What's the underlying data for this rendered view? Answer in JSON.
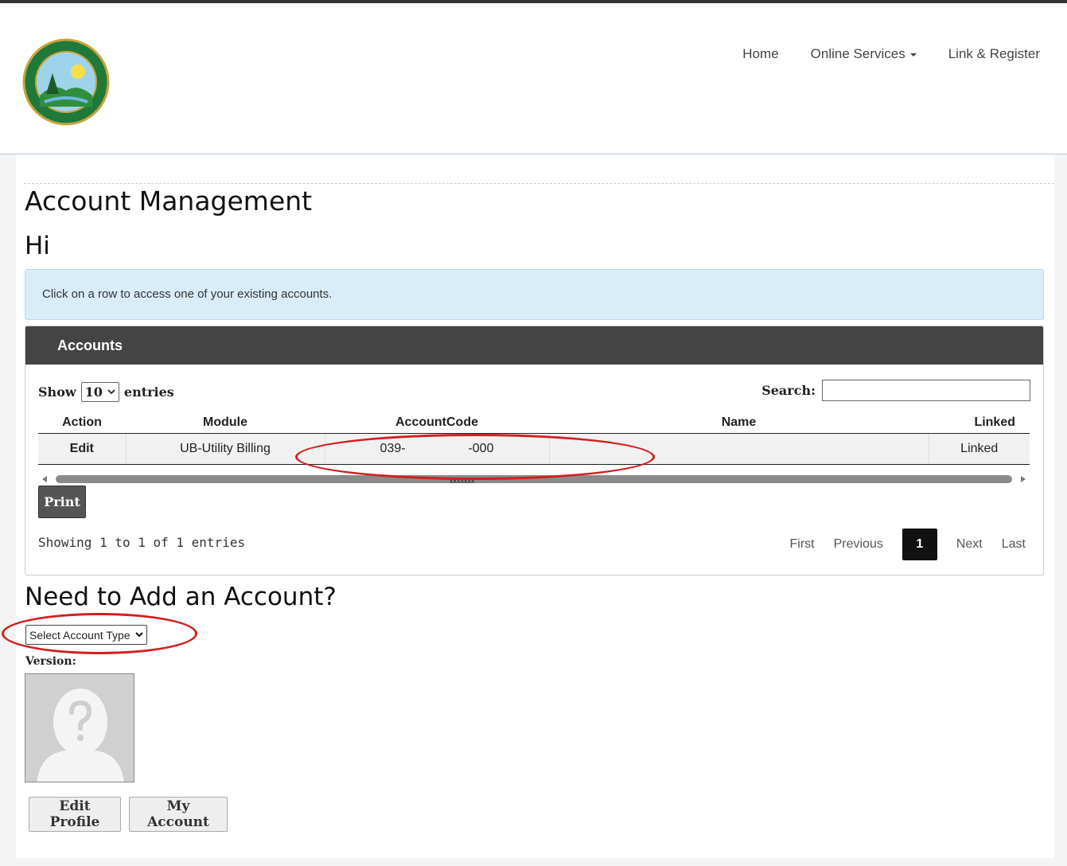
{
  "nav": {
    "items": [
      "Home",
      "Online Services",
      "Link & Register"
    ]
  },
  "page": {
    "title": "Account Management",
    "greeting": "Hi",
    "info": "Click on a row to access one of your existing accounts."
  },
  "panel": {
    "title": "Accounts",
    "show_label": "Show",
    "entries_label": "entries",
    "entries_value": "10",
    "search_label": "Search:",
    "columns": [
      "Action",
      "Module",
      "AccountCode",
      "Name",
      "Linked"
    ],
    "rows": [
      {
        "action": "Edit",
        "module": "UB-Utility Billing",
        "code_start": "039-",
        "code_end": "-000",
        "name": "",
        "linked": "Linked"
      }
    ],
    "redaction": "xxxxxxx",
    "print": "Print",
    "showing": "Showing 1 to 1 of 1 entries",
    "pager": {
      "first": "First",
      "previous": "Previous",
      "current": "1",
      "next": "Next",
      "last": "Last"
    }
  },
  "add": {
    "heading": "Need to Add an Account?",
    "select_value": "Select Account Type",
    "version_label": "Version:"
  },
  "profile": {
    "edit": "Edit Profile",
    "account": "My Account"
  },
  "colors": {
    "accent_dark": "#444444",
    "info_bg": "#d9edf9",
    "annotation": "#d21f1f"
  }
}
